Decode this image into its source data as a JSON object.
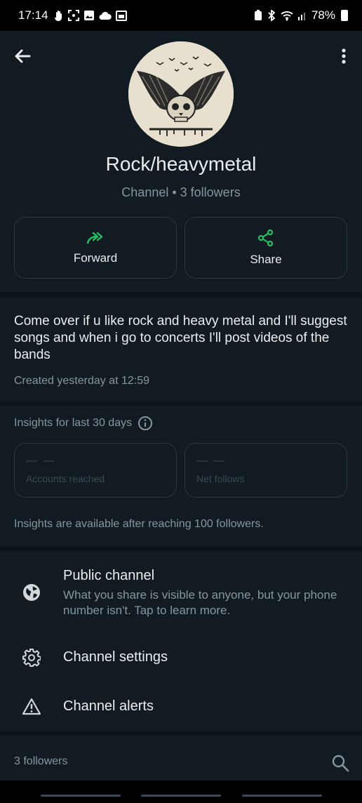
{
  "status": {
    "time": "17:14",
    "battery": "78%"
  },
  "header": {
    "title": "Rock/heavymetal",
    "subtitle": "Channel • 3 followers",
    "icons": {
      "back": "back-arrow-icon",
      "more": "more-vert-icon"
    }
  },
  "actions": {
    "forward_label": "Forward",
    "share_label": "Share",
    "accent": "#21c063"
  },
  "description": {
    "text": "Come over if u like rock and heavy metal and I'll suggest songs and when i go to concerts I'll post videos of  the bands",
    "created": "Created yesterday at 12:59"
  },
  "insights": {
    "heading": "Insights for last 30 days",
    "cards": [
      {
        "value": "— —",
        "label": "Accounts reached"
      },
      {
        "value": "— —",
        "label": "Net follows"
      }
    ],
    "note": "Insights are available after reaching 100 followers."
  },
  "options": [
    {
      "icon": "globe-icon",
      "title": "Public channel",
      "description": "What you share is visible to anyone, but your phone number isn't. Tap to learn more."
    },
    {
      "icon": "gear-icon",
      "title": "Channel settings"
    },
    {
      "icon": "warning-icon",
      "title": "Channel alerts"
    }
  ],
  "followers": {
    "label": "3 followers"
  }
}
